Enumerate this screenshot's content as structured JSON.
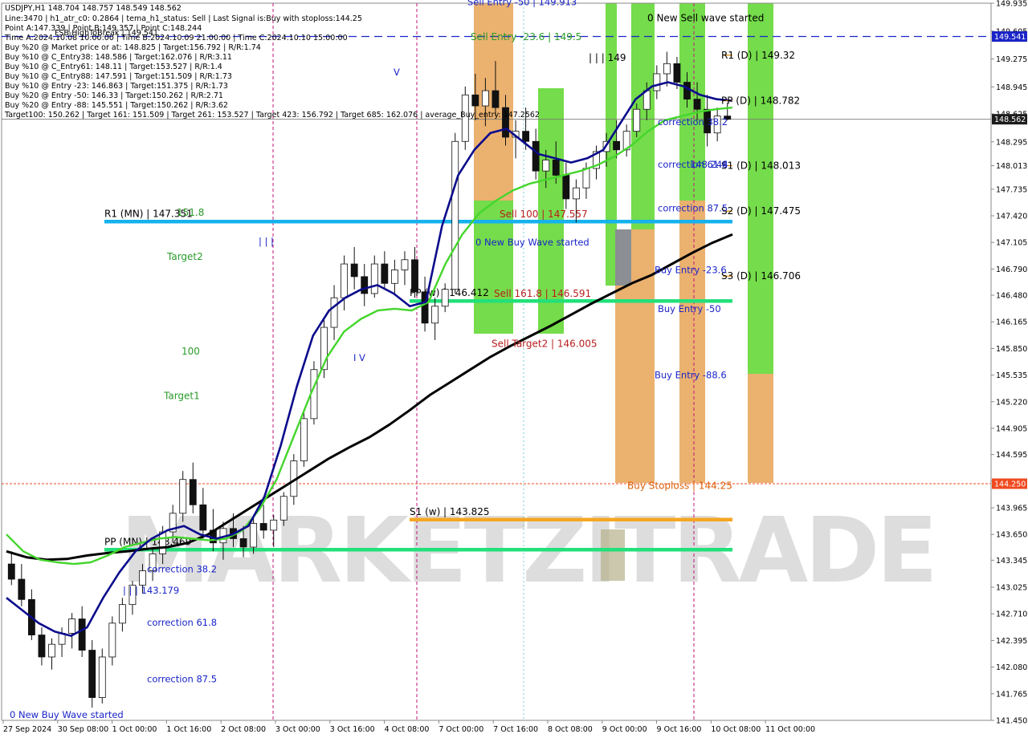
{
  "info": {
    "lines": [
      "USDJPY,H1  148.704 148.757 148.549 148.562",
      "Line:3470 | h1_atr_c0: 0.2864 | tema_h1_status: Sell | Last Signal is:Buy with stoploss:144.25",
      "Point A:147.339 | Point B:149.357 | Point C:148.244",
      "Time A:2024.10.08 10:00:00 | Time B:2024.10.09 21:00:00 | Time C:2024.10.10 15:00:00",
      "Buy %20 @ Market price or at: 148.825 | Target:156.792 | R/R:1.74",
      "Buy %10 @ C_Entry38: 148.586 | Target:162.076 | R/R:3.11",
      "Buy %10 @ C_Entry61: 148.11 | Target:153.527 | R/R:1.4",
      "Buy %10 @ C_Entry88: 147.591 | Target:151.509 | R/R:1.73",
      "Buy %10 @ Entry -23: 146.863 | Target:151.375 | R/R:1.73",
      "Buy %20 @ Entry -50: 146.33 | Target:150.262 | R/R:2.71",
      "Buy %20 @ Entry -88: 145.551 | Target:150.262 | R/R:3.62",
      "Target100: 150.262 | Target 161: 151.509 | Target 261: 153.527 | Target 423: 156.792 | Target 685: 162.076 | average_Buy_entry: 147.2562"
    ],
    "overlap_label": "FSB-HighToBreak | 149.541"
  },
  "chart_data": {
    "type": "candlestick",
    "symbol": "USDJPY",
    "timeframe": "H1",
    "ohlc_last": {
      "open": 148.704,
      "high": 148.757,
      "low": 148.549,
      "close": 148.562
    },
    "ylim": [
      141.45,
      149.935
    ],
    "x_labels": [
      "27 Sep 2024",
      "30 Sep 08:00",
      "1 Oct 00:00",
      "1 Oct 16:00",
      "2 Oct 08:00",
      "3 Oct 00:00",
      "3 Oct 16:00",
      "4 Oct 08:00",
      "7 Oct 00:00",
      "7 Oct 16:00",
      "8 Oct 08:00",
      "9 Oct 00:00",
      "9 Oct 16:00",
      "10 Oct 08:00",
      "11 Oct 00:00"
    ],
    "y_ticks": [
      "149.935",
      "149.605",
      "149.275",
      "148.945",
      "148.625",
      "148.295",
      "148.013",
      "147.735",
      "147.420",
      "147.105",
      "146.790",
      "146.480",
      "146.165",
      "145.850",
      "145.535",
      "145.220",
      "144.905",
      "144.595",
      "144.280",
      "143.965",
      "143.650",
      "143.345",
      "143.025",
      "142.710",
      "142.395",
      "142.080",
      "141.765",
      "141.450"
    ],
    "price_tags": [
      {
        "label": "149.541",
        "value": 149.541,
        "color": "#1a24c8"
      },
      {
        "label": "148.562",
        "value": 148.562,
        "color": "#1c1c1c"
      },
      {
        "label": "144.250",
        "value": 144.25,
        "color": "#f04a20"
      }
    ],
    "hlines": [
      {
        "name": "R1 (MN)",
        "label": "R1 (MN) | 147.351",
        "value": 147.351,
        "color": "#16b2ee"
      },
      {
        "name": "PP (w)",
        "label": "PP (w) | 146.412",
        "value": 146.412,
        "color": "#22e07a"
      },
      {
        "name": "S1 (w)",
        "label": "S1 (w) | 143.825",
        "value": 143.825,
        "color": "#f5a623"
      },
      {
        "name": "PP (MN)",
        "label": "PP (MN) | 143.469",
        "value": 143.469,
        "color": "#22e07a"
      }
    ],
    "daily_levels": [
      {
        "label": "R1 (D) | 149.32",
        "value": 149.32
      },
      {
        "label": "PP (D) | 148.782",
        "value": 148.782
      },
      {
        "label": "S1 (D) | 148.013",
        "value": 148.013
      },
      {
        "label": "S2 (D) | 147.475",
        "value": 147.475
      },
      {
        "label": "S3 (D) | 146.706",
        "value": 146.706
      }
    ],
    "annotations": [
      {
        "text": "Sell Entry -50 | 149.913",
        "t": 0.72,
        "value": 149.913,
        "color": "blue"
      },
      {
        "text": "Sell Entry -23.6 | 149.5",
        "t": 0.72,
        "value": 149.5,
        "color": "green"
      },
      {
        "text": "0 New Sell wave started",
        "t": 0.96,
        "value": 149.72,
        "color": "black"
      },
      {
        "text": "| | | 149",
        "t": 0.86,
        "value": 149.25,
        "color": "black"
      },
      {
        "text": "correction 38.2",
        "t": 1.0,
        "value": 148.49,
        "color": "blue"
      },
      {
        "text": "correction 61.8",
        "t": 1.0,
        "value": 147.99,
        "color": "blue"
      },
      {
        "text": "148.244",
        "t": 1.0,
        "value": 147.99,
        "color": "blue"
      },
      {
        "text": "correction 87.5",
        "t": 1.0,
        "value": 147.47,
        "color": "blue"
      },
      {
        "text": "Sell 100 | 147.557",
        "t": 0.77,
        "value": 147.4,
        "color": "red"
      },
      {
        "text": "0 New Buy Wave started",
        "t": 0.77,
        "value": 147.07,
        "color": "blue"
      },
      {
        "text": "Sell 161.8 | 146.591",
        "t": 0.77,
        "value": 146.46,
        "color": "red"
      },
      {
        "text": "Sell Target2 | 146.005",
        "t": 0.77,
        "value": 145.87,
        "color": "red"
      },
      {
        "text": "Buy Entry -23.6",
        "t": 1.0,
        "value": 146.74,
        "color": "blue"
      },
      {
        "text": "Buy Entry -50",
        "t": 1.0,
        "value": 146.28,
        "color": "blue"
      },
      {
        "text": "Buy Entry -88.6",
        "t": 1.0,
        "value": 145.5,
        "color": "blue"
      },
      {
        "text": "Buy Stoploss | 144.25",
        "t": 1.0,
        "value": 144.19,
        "color": "orange"
      },
      {
        "text": "151.8",
        "t": 0.24,
        "value": 147.42,
        "color": "green"
      },
      {
        "text": "Target2",
        "t": 0.24,
        "value": 146.9,
        "color": "green"
      },
      {
        "text": "100",
        "t": 0.24,
        "value": 145.78,
        "color": "green"
      },
      {
        "text": "Target1",
        "t": 0.24,
        "value": 145.25,
        "color": "green"
      },
      {
        "text": "| | |",
        "t": 0.335,
        "value": 147.08,
        "color": "blue"
      },
      {
        "text": "V",
        "t": 0.56,
        "value": 149.08,
        "color": "blue"
      },
      {
        "text": "I V",
        "t": 0.5,
        "value": 145.7,
        "color": "blue"
      },
      {
        "text": "correction 38.2",
        "t": 0.22,
        "value": 143.2,
        "color": "blue"
      },
      {
        "text": "| | | 143.179",
        "t": 0.22,
        "value": 142.95,
        "color": "blue"
      },
      {
        "text": "correction 61.8",
        "t": 0.22,
        "value": 142.57,
        "color": "blue"
      },
      {
        "text": "correction 87.5",
        "t": 0.22,
        "value": 141.9,
        "color": "blue"
      },
      {
        "text": "0 New Buy Wave started",
        "t": 0.07,
        "value": 141.48,
        "color": "blue"
      }
    ],
    "watermark": "MARKETZITRADE",
    "start_price": 143.3,
    "candles": [
      [
        143.3,
        143.45,
        143.05,
        143.12
      ],
      [
        143.12,
        143.3,
        142.8,
        142.88
      ],
      [
        142.88,
        143.0,
        142.4,
        142.46
      ],
      [
        142.46,
        142.55,
        142.1,
        142.2
      ],
      [
        142.2,
        142.42,
        142.05,
        142.35
      ],
      [
        142.35,
        142.55,
        142.2,
        142.48
      ],
      [
        142.48,
        142.72,
        142.3,
        142.65
      ],
      [
        142.65,
        142.8,
        142.2,
        142.28
      ],
      [
        142.28,
        142.4,
        141.6,
        141.72
      ],
      [
        141.72,
        142.3,
        141.65,
        142.2
      ],
      [
        142.2,
        142.68,
        142.1,
        142.6
      ],
      [
        142.6,
        142.9,
        142.5,
        142.82
      ],
      [
        142.82,
        143.1,
        142.7,
        143.05
      ],
      [
        143.05,
        143.3,
        142.95,
        143.22
      ],
      [
        143.22,
        143.5,
        143.1,
        143.42
      ],
      [
        143.42,
        143.75,
        143.3,
        143.68
      ],
      [
        143.68,
        144.0,
        143.55,
        143.9
      ],
      [
        143.9,
        144.4,
        143.8,
        144.3
      ],
      [
        144.3,
        144.5,
        143.9,
        144.0
      ],
      [
        144.0,
        144.2,
        143.6,
        143.7
      ],
      [
        143.7,
        143.95,
        143.45,
        143.55
      ],
      [
        143.55,
        143.8,
        143.35,
        143.72
      ],
      [
        143.72,
        143.9,
        143.5,
        143.6
      ],
      [
        143.6,
        143.75,
        143.38,
        143.5
      ],
      [
        143.5,
        143.85,
        143.42,
        143.78
      ],
      [
        143.78,
        144.0,
        143.6,
        143.7
      ],
      [
        143.7,
        143.88,
        143.5,
        143.82
      ],
      [
        143.82,
        144.15,
        143.75,
        144.1
      ],
      [
        144.1,
        144.6,
        144.0,
        144.52
      ],
      [
        144.52,
        145.1,
        144.45,
        145.02
      ],
      [
        145.02,
        145.7,
        144.95,
        145.6
      ],
      [
        145.6,
        146.2,
        145.5,
        146.1
      ],
      [
        146.1,
        146.6,
        145.95,
        146.45
      ],
      [
        146.45,
        146.95,
        146.3,
        146.85
      ],
      [
        146.85,
        147.05,
        146.55,
        146.7
      ],
      [
        146.7,
        146.85,
        146.35,
        146.5
      ],
      [
        146.5,
        146.95,
        146.45,
        146.85
      ],
      [
        146.85,
        147.0,
        146.55,
        146.62
      ],
      [
        146.62,
        146.9,
        146.5,
        146.78
      ],
      [
        146.78,
        147.0,
        146.6,
        146.9
      ],
      [
        146.9,
        147.05,
        146.45,
        146.52
      ],
      [
        146.52,
        146.7,
        146.05,
        146.15
      ],
      [
        146.15,
        146.45,
        145.95,
        146.35
      ],
      [
        146.35,
        146.62,
        146.28,
        146.55
      ],
      [
        146.55,
        148.4,
        146.5,
        148.3
      ],
      [
        148.3,
        148.95,
        148.2,
        148.85
      ],
      [
        148.85,
        149.1,
        148.55,
        148.72
      ],
      [
        148.72,
        149.05,
        148.48,
        148.9
      ],
      [
        148.9,
        149.25,
        148.6,
        148.7
      ],
      [
        148.7,
        148.85,
        148.25,
        148.35
      ],
      [
        148.35,
        148.55,
        148.1,
        148.42
      ],
      [
        148.42,
        148.7,
        148.2,
        148.3
      ],
      [
        148.3,
        148.45,
        147.85,
        147.95
      ],
      [
        147.95,
        148.2,
        147.75,
        148.08
      ],
      [
        148.08,
        148.3,
        147.8,
        147.9
      ],
      [
        147.9,
        148.05,
        147.5,
        147.62
      ],
      [
        147.62,
        147.85,
        147.34,
        147.75
      ],
      [
        147.75,
        148.05,
        147.62,
        147.98
      ],
      [
        147.98,
        148.25,
        147.85,
        148.18
      ],
      [
        148.18,
        148.4,
        148.0,
        148.3
      ],
      [
        148.3,
        148.55,
        148.1,
        148.2
      ],
      [
        148.2,
        148.5,
        148.12,
        148.42
      ],
      [
        148.42,
        148.75,
        148.35,
        148.68
      ],
      [
        148.68,
        149.0,
        148.55,
        148.9
      ],
      [
        148.9,
        149.2,
        148.8,
        149.1
      ],
      [
        149.1,
        149.36,
        148.95,
        149.22
      ],
      [
        149.22,
        149.3,
        148.92,
        149.0
      ],
      [
        149.0,
        149.12,
        148.7,
        148.8
      ],
      [
        148.8,
        149.0,
        148.55,
        148.68
      ],
      [
        148.68,
        148.85,
        148.24,
        148.4
      ],
      [
        148.4,
        148.7,
        148.3,
        148.6
      ],
      [
        148.6,
        148.757,
        148.549,
        148.562
      ]
    ],
    "ma_blue": [
      142.9,
      142.75,
      142.6,
      142.5,
      142.45,
      142.55,
      142.9,
      143.2,
      143.45,
      143.6,
      143.7,
      143.75,
      143.65,
      143.6,
      143.65,
      143.75,
      144.1,
      144.7,
      145.4,
      146.0,
      146.3,
      146.45,
      146.55,
      146.6,
      146.5,
      146.35,
      146.4,
      147.3,
      147.9,
      148.2,
      148.4,
      148.45,
      148.3,
      148.15,
      148.1,
      148.05,
      148.1,
      148.2,
      148.5,
      148.8,
      148.95,
      149.0,
      148.95,
      148.85,
      148.8,
      148.78
    ],
    "ma_green": [
      143.65,
      143.45,
      143.35,
      143.32,
      143.3,
      143.32,
      143.4,
      143.5,
      143.55,
      143.6,
      143.62,
      143.6,
      143.58,
      143.6,
      143.7,
      143.95,
      144.3,
      144.8,
      145.3,
      145.75,
      146.05,
      146.2,
      146.3,
      146.32,
      146.3,
      146.4,
      146.85,
      147.2,
      147.45,
      147.6,
      147.72,
      147.8,
      147.85,
      147.9,
      147.95,
      148.02,
      148.12,
      148.25,
      148.42,
      148.55,
      148.6,
      148.65,
      148.68,
      148.7
    ],
    "ma_black": [
      143.45,
      143.38,
      143.35,
      143.36,
      143.4,
      143.43,
      143.45,
      143.48,
      143.5,
      143.55,
      143.65,
      143.8,
      143.95,
      144.1,
      144.25,
      144.4,
      144.55,
      144.68,
      144.8,
      144.95,
      145.12,
      145.3,
      145.45,
      145.6,
      145.75,
      145.88,
      146.0,
      146.12,
      146.25,
      146.38,
      146.5,
      146.62,
      146.72,
      146.85,
      146.98,
      147.1,
      147.2
    ]
  }
}
